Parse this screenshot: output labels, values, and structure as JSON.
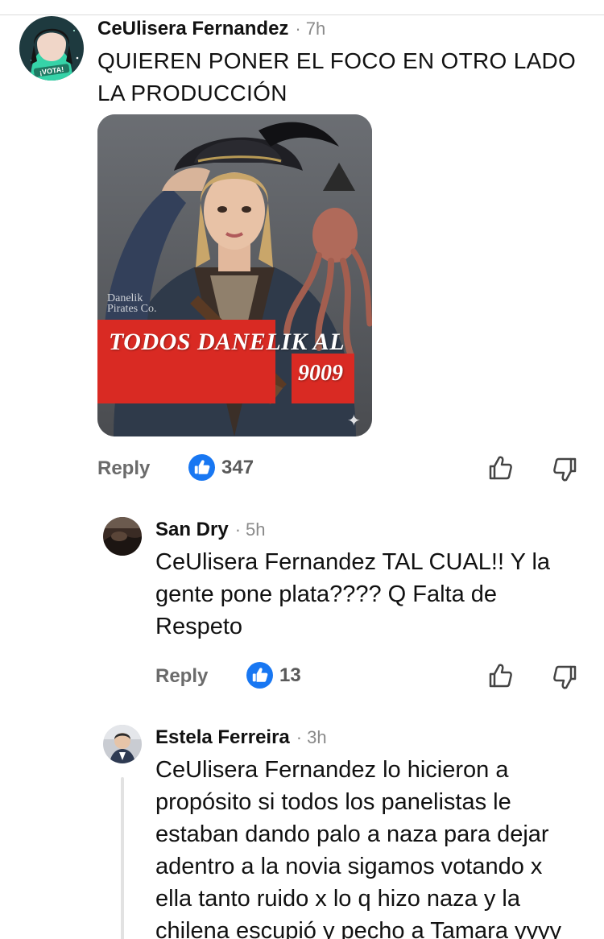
{
  "colors": {
    "like_badge": "#1877f2",
    "banner_red": "#d92a23",
    "meta_gray": "#8a8a8a",
    "action_gray": "#6b6b6b"
  },
  "comments": [
    {
      "author": "CeUlisera Fernandez",
      "separator": "·",
      "time": "7h",
      "text_line1": "QUIEREN PONER EL FOCO EN OTRO LADO",
      "text_line2": "LA PRODUCCIÓN",
      "avatar_badge": "¡VOTA!",
      "image": {
        "banner_line1": "TODOS DANELIK AL",
        "banner_line2": "9009",
        "watermark": "Danelik\nPirates Co.",
        "sparkle_icon": "✦"
      },
      "reply_label": "Reply",
      "likes": "347",
      "like_icon": "thumbs-up-badge-icon",
      "upvote_icon": "thumbs-up-outline-icon",
      "downvote_icon": "thumbs-down-outline-icon"
    },
    {
      "author": "San Dry",
      "separator": "·",
      "time": "5h",
      "text_line1": "CeUlisera Fernandez TAL CUAL!! Y la",
      "text_line2": "gente pone plata???? Q Falta de",
      "text_line3": "Respeto",
      "reply_label": "Reply",
      "likes": "13"
    },
    {
      "author": "Estela Ferreira",
      "separator": "·",
      "time": "3h",
      "text_line1": "CeUlisera Fernandez lo hicieron a",
      "text_line2": "propósito si todos los panelistas le",
      "text_line3": "estaban dando palo a naza para dejar",
      "text_line4": "adentro a la novia sigamos votando x",
      "text_line5": "ella tanto ruido x lo q hizo naza y la",
      "text_line6": "chilena escupió y pecho a Tamara yyyy"
    }
  ]
}
